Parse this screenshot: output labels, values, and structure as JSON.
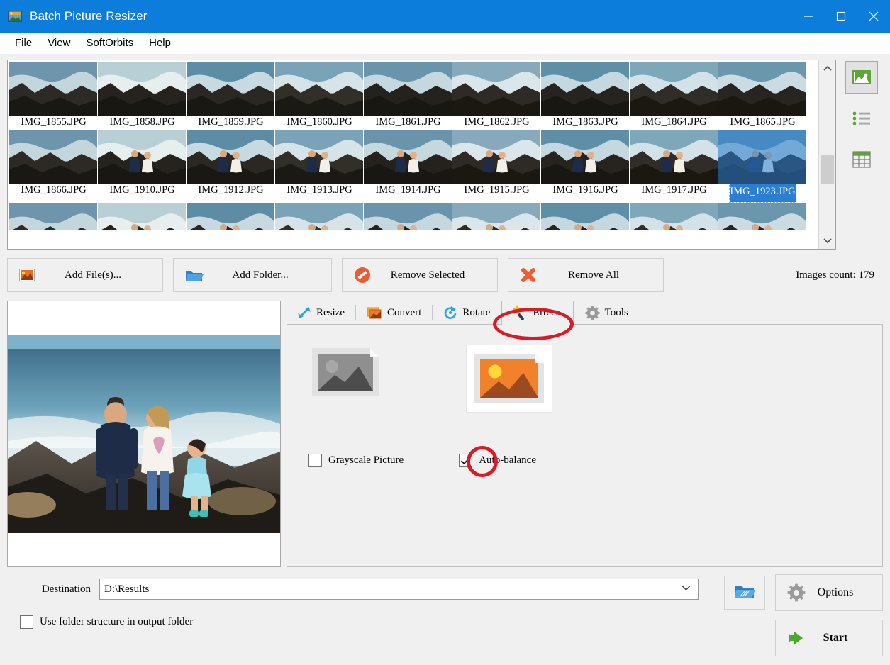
{
  "window": {
    "title": "Batch Picture Resizer",
    "app_icon": "picture-icon",
    "controls": {
      "minimize": "minimize-icon",
      "maximize": "maximize-icon",
      "close": "close-icon"
    },
    "titlebar_color": "#0d7ddb"
  },
  "menu": [
    {
      "name": "file",
      "label": "File",
      "accel": "F"
    },
    {
      "name": "view",
      "label": "View",
      "accel": "V"
    },
    {
      "name": "softorbits",
      "label": "SoftOrbits",
      "accel": ""
    },
    {
      "name": "help",
      "label": "Help",
      "accel": "H"
    }
  ],
  "thumbnails": {
    "rows": [
      [
        "IMG_1855.JPG",
        "IMG_1858.JPG",
        "IMG_1859.JPG",
        "IMG_1860.JPG",
        "IMG_1861.JPG",
        "IMG_1862.JPG",
        "IMG_1863.JPG",
        "IMG_1864.JPG",
        "IMG_1865.JPG"
      ],
      [
        "IMG_1866.JPG",
        "IMG_1910.JPG",
        "IMG_1912.JPG",
        "IMG_1913.JPG",
        "IMG_1914.JPG",
        "IMG_1915.JPG",
        "IMG_1916.JPG",
        "IMG_1917.JPG",
        "IMG_1923.JPG"
      ]
    ],
    "selected": "IMG_1923.JPG",
    "selection_color": "#2a7fd4",
    "scroll_position_pct": 62
  },
  "view_modes": [
    {
      "name": "thumbnail-view",
      "icon": "picture-icon",
      "active": true
    },
    {
      "name": "list-view",
      "icon": "list-icon",
      "active": false
    },
    {
      "name": "details-view",
      "icon": "table-grid-icon",
      "active": false
    }
  ],
  "toolbar": {
    "add_files": {
      "label": "Add File(s)...",
      "accel": "i",
      "icon": "picture-add-icon"
    },
    "add_folder": {
      "label": "Add Folder...",
      "accel": "o",
      "icon": "folder-open-icon"
    },
    "remove_selected": {
      "label": "Remove Selected",
      "accel": "S",
      "icon": "no-entry-icon"
    },
    "remove_all": {
      "label": "Remove All",
      "accel": "A",
      "icon": "red-x-icon"
    },
    "images_count": "Images count: 179"
  },
  "tabs": [
    {
      "name": "resize",
      "label": "Resize",
      "icon": "resize-arrows-icon",
      "active": false
    },
    {
      "name": "convert",
      "label": "Convert",
      "icon": "convert-stack-icon",
      "active": false
    },
    {
      "name": "rotate",
      "label": "Rotate",
      "icon": "rotate-circular-arrow-icon",
      "active": false
    },
    {
      "name": "effects",
      "label": "Effects",
      "icon": "magic-wand-icon",
      "active": true
    },
    {
      "name": "tools",
      "label": "Tools",
      "icon": "gear-icon",
      "active": false
    }
  ],
  "effects_panel": {
    "grayscale_preview": {
      "name": "grayscale-preview",
      "selected": false
    },
    "color_preview": {
      "name": "color-preview",
      "selected": true
    },
    "checkboxes": [
      {
        "name": "grayscale-picture",
        "label": "Grayscale Picture",
        "checked": false
      },
      {
        "name": "auto-balance",
        "label": "Auto-balance",
        "checked": true
      }
    ]
  },
  "preview": {
    "name": "image-preview",
    "description": "family photo on rocks by the ocean"
  },
  "bottom": {
    "destination_label": "Destination",
    "destination_value": "D:\\Results",
    "browse_button": {
      "name": "browse-folder-button",
      "icon": "folder-browse-icon"
    },
    "folder_structure": {
      "label": "Use folder structure in output folder",
      "checked": false
    },
    "options_button": {
      "label": "Options",
      "icon": "gear-icon"
    },
    "start_button": {
      "label": "Start",
      "icon": "green-arrow-icon"
    }
  },
  "annotations": [
    {
      "name": "annotation-effects-tab",
      "shape": "ellipse",
      "color": "#d81b26"
    },
    {
      "name": "annotation-autobalance-checkbox",
      "shape": "circle",
      "color": "#d81b26"
    }
  ]
}
